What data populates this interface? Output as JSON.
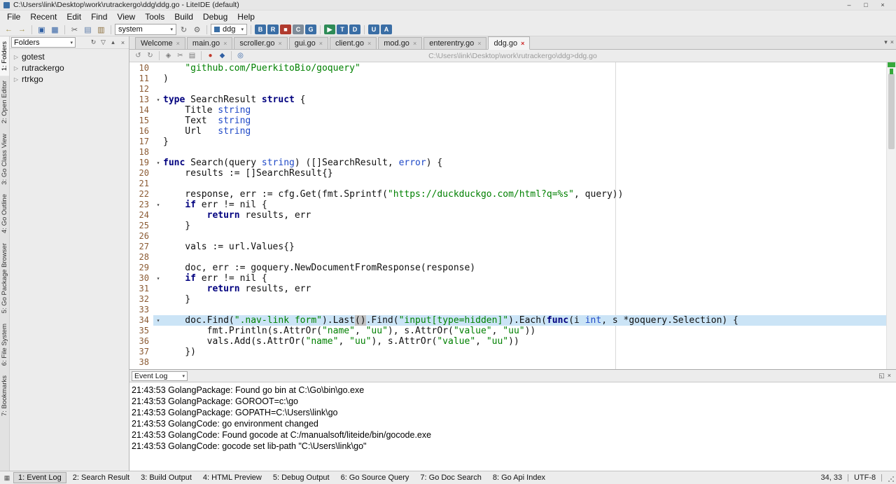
{
  "window": {
    "title": "C:\\Users\\link\\Desktop\\work\\rutrackergo\\ddg\\ddg.go - LiteIDE (default)",
    "minimize": "–",
    "maximize": "□",
    "close": "×"
  },
  "colors": {
    "chrome": "#ececec",
    "editor_bg": "#ffffff",
    "current_line": "#cbe4f6",
    "keyword": "#00007f",
    "type": "#1f49c7",
    "string": "#008000",
    "line_number": "#8b5a32",
    "modified_mark": "#37a93c",
    "active_tab_close": "#cc2222"
  },
  "menubar": {
    "items": [
      "File",
      "Recent",
      "Edit",
      "Find",
      "View",
      "Tools",
      "Build",
      "Debug",
      "Help"
    ]
  },
  "toolbar": {
    "items": [
      {
        "t": "icon",
        "name": "back-icon",
        "g": "←",
        "c": "#9f8f46"
      },
      {
        "t": "icon",
        "name": "forward-icon",
        "g": "→",
        "c": "#9f8f46"
      },
      {
        "t": "sep"
      },
      {
        "t": "icon",
        "name": "save-icon",
        "g": "▣",
        "c": "#2f5fa3"
      },
      {
        "t": "icon",
        "name": "save-all-icon",
        "g": "▦",
        "c": "#2f5fa3"
      },
      {
        "t": "sep"
      },
      {
        "t": "icon",
        "name": "cut-icon",
        "g": "✂",
        "c": "#5c5c5c"
      },
      {
        "t": "icon",
        "name": "copy-icon",
        "g": "▤",
        "c": "#5c7ba8"
      },
      {
        "t": "icon",
        "name": "paste-icon",
        "g": "▥",
        "c": "#8a6d3a"
      },
      {
        "t": "sep"
      },
      {
        "t": "combo",
        "name": "env-combo",
        "value": "system"
      },
      {
        "t": "icon",
        "name": "reload-env-icon",
        "g": "↻",
        "c": "#666666"
      },
      {
        "t": "icon",
        "name": "gear-icon",
        "g": "⚙",
        "c": "#666666"
      },
      {
        "t": "sep"
      },
      {
        "t": "field",
        "name": "target-field",
        "value": "ddg"
      },
      {
        "t": "sep"
      },
      {
        "t": "build",
        "name": "build-icon",
        "g": "B",
        "c": "#3a6ea5"
      },
      {
        "t": "build",
        "name": "build-run-icon",
        "g": "R",
        "c": "#3a6ea5"
      },
      {
        "t": "build",
        "name": "stop-icon",
        "g": "■",
        "c": "#b03a2e"
      },
      {
        "t": "build",
        "name": "clean-icon",
        "g": "C",
        "c": "#7f8c99"
      },
      {
        "t": "build",
        "name": "get-icon",
        "g": "G",
        "c": "#3a6ea5"
      },
      {
        "t": "sep"
      },
      {
        "t": "build",
        "name": "run-icon",
        "g": "▶",
        "c": "#2e8b57"
      },
      {
        "t": "build",
        "name": "test-icon",
        "g": "T",
        "c": "#3a6ea5"
      },
      {
        "t": "build",
        "name": "debug-icon",
        "g": "D",
        "c": "#3a6ea5"
      },
      {
        "t": "sep"
      },
      {
        "t": "build",
        "name": "godoc-icon",
        "g": "U",
        "c": "#3a6ea5"
      },
      {
        "t": "build",
        "name": "api-icon",
        "g": "A",
        "c": "#3a6ea5"
      }
    ]
  },
  "side_tabs": {
    "active_index": 0,
    "items": [
      "1: Folders",
      "2: Open Editor",
      "3: Go Class View",
      "4: Go Outline",
      "5: Go Package Browser",
      "6: File System",
      "7: Bookmarks"
    ]
  },
  "folders_pane": {
    "title": "Folders",
    "icons": [
      {
        "name": "sync-icon",
        "g": "↻"
      },
      {
        "name": "filter-icon",
        "g": "▽"
      },
      {
        "name": "collapse-all-icon",
        "g": "▴"
      },
      {
        "name": "close-pane-icon",
        "g": "×"
      }
    ],
    "items": [
      "gotest",
      "rutrackergo",
      "rtrkgo"
    ]
  },
  "editor": {
    "tabs": [
      {
        "label": "Welcome"
      },
      {
        "label": "main.go"
      },
      {
        "label": "scroller.go"
      },
      {
        "label": "gui.go"
      },
      {
        "label": "client.go"
      },
      {
        "label": "mod.go"
      },
      {
        "label": "enterentry.go"
      },
      {
        "label": "ddg.go",
        "active": true
      }
    ],
    "tabbar_controls": [
      {
        "name": "tab-list-icon",
        "g": "▾"
      },
      {
        "name": "tab-close-all-icon",
        "g": "×"
      }
    ],
    "toolbar_icons": [
      {
        "t": "icon",
        "name": "undo-icon",
        "g": "↺",
        "c": "#7a7a7a"
      },
      {
        "t": "icon",
        "name": "redo-icon",
        "g": "↻",
        "c": "#7a7a7a"
      },
      {
        "t": "sep"
      },
      {
        "t": "icon",
        "name": "lock-icon",
        "g": "◈",
        "c": "#7a7a7a"
      },
      {
        "t": "icon",
        "name": "cut-icon",
        "g": "✂",
        "c": "#7a7a7a"
      },
      {
        "t": "icon",
        "name": "copy-icon",
        "g": "▤",
        "c": "#7a7a7a"
      },
      {
        "t": "sep"
      },
      {
        "t": "icon",
        "name": "record-icon",
        "g": "●",
        "c": "#c0392b"
      },
      {
        "t": "icon",
        "name": "build-file-icon",
        "g": "◆",
        "c": "#2f5fa3"
      },
      {
        "t": "sep"
      },
      {
        "t": "icon",
        "name": "grep-icon",
        "g": "◎",
        "c": "#2f5fa3"
      }
    ],
    "path": "C:\\Users\\link\\Desktop\\work\\rutrackergo\\ddg>ddg.go",
    "active_line": 34,
    "lines": [
      {
        "n": 10,
        "tk": [
          [
            "p",
            "    "
          ],
          [
            "s",
            "\"github.com/PuerkitoBio/goquery\""
          ]
        ]
      },
      {
        "n": 11,
        "tk": [
          [
            "p",
            ")"
          ]
        ]
      },
      {
        "n": 12,
        "tk": []
      },
      {
        "n": 13,
        "fold": true,
        "tk": [
          [
            "k",
            "type"
          ],
          [
            "p",
            " SearchResult "
          ],
          [
            "k",
            "struct"
          ],
          [
            "p",
            " {"
          ]
        ]
      },
      {
        "n": 14,
        "tk": [
          [
            "p",
            "    Title "
          ],
          [
            "t",
            "string"
          ]
        ]
      },
      {
        "n": 15,
        "tk": [
          [
            "p",
            "    Text  "
          ],
          [
            "t",
            "string"
          ]
        ]
      },
      {
        "n": 16,
        "tk": [
          [
            "p",
            "    Url   "
          ],
          [
            "t",
            "string"
          ]
        ]
      },
      {
        "n": 17,
        "tk": [
          [
            "p",
            "}"
          ]
        ]
      },
      {
        "n": 18,
        "tk": []
      },
      {
        "n": 19,
        "fold": true,
        "tk": [
          [
            "k",
            "func"
          ],
          [
            "p",
            " Search(query "
          ],
          [
            "t",
            "string"
          ],
          [
            "p",
            ") ([]SearchResult, "
          ],
          [
            "t",
            "error"
          ],
          [
            "p",
            ") {"
          ]
        ]
      },
      {
        "n": 20,
        "tk": [
          [
            "p",
            "    results := []SearchResult{}"
          ]
        ]
      },
      {
        "n": 21,
        "tk": []
      },
      {
        "n": 22,
        "tk": [
          [
            "p",
            "    response, err := cfg.Get(fmt.Sprintf("
          ],
          [
            "s",
            "\"https://duckduckgo.com/html?q=%s\""
          ],
          [
            "p",
            ", query))"
          ]
        ]
      },
      {
        "n": 23,
        "fold": true,
        "tk": [
          [
            "p",
            "    "
          ],
          [
            "k",
            "if"
          ],
          [
            "p",
            " err != nil {"
          ]
        ]
      },
      {
        "n": 24,
        "tk": [
          [
            "p",
            "        "
          ],
          [
            "k",
            "return"
          ],
          [
            "p",
            " results, err"
          ]
        ]
      },
      {
        "n": 25,
        "tk": [
          [
            "p",
            "    }"
          ]
        ]
      },
      {
        "n": 26,
        "tk": []
      },
      {
        "n": 27,
        "tk": [
          [
            "p",
            "    vals := url.Values{}"
          ]
        ]
      },
      {
        "n": 28,
        "tk": []
      },
      {
        "n": 29,
        "tk": [
          [
            "p",
            "    doc, err := goquery.NewDocumentFromResponse(response)"
          ]
        ]
      },
      {
        "n": 30,
        "fold": true,
        "tk": [
          [
            "p",
            "    "
          ],
          [
            "k",
            "if"
          ],
          [
            "p",
            " err != nil {"
          ]
        ]
      },
      {
        "n": 31,
        "tk": [
          [
            "p",
            "        "
          ],
          [
            "k",
            "return"
          ],
          [
            "p",
            " results, err"
          ]
        ]
      },
      {
        "n": 32,
        "tk": [
          [
            "p",
            "    }"
          ]
        ]
      },
      {
        "n": 33,
        "tk": []
      },
      {
        "n": 34,
        "fold": true,
        "tk": [
          [
            "p",
            "    doc.Find("
          ],
          [
            "s",
            "\".nav-link form\""
          ],
          [
            "p",
            ").Last"
          ],
          [
            "h",
            "()"
          ],
          [
            "p",
            ".Find("
          ],
          [
            "s",
            "\"input[type=hidden]\""
          ],
          [
            "p",
            ").Each("
          ],
          [
            "k",
            "func"
          ],
          [
            "p",
            "(i "
          ],
          [
            "t",
            "int"
          ],
          [
            "p",
            ", s *goquery.Selection) {"
          ]
        ]
      },
      {
        "n": 35,
        "tk": [
          [
            "p",
            "        fmt.Println(s.AttrOr("
          ],
          [
            "s",
            "\"name\""
          ],
          [
            "p",
            ", "
          ],
          [
            "s",
            "\"uu\""
          ],
          [
            "p",
            "), s.AttrOr("
          ],
          [
            "s",
            "\"value\""
          ],
          [
            "p",
            ", "
          ],
          [
            "s",
            "\"uu\""
          ],
          [
            "p",
            "))"
          ]
        ]
      },
      {
        "n": 36,
        "tk": [
          [
            "p",
            "        vals.Add(s.AttrOr("
          ],
          [
            "s",
            "\"name\""
          ],
          [
            "p",
            ", "
          ],
          [
            "s",
            "\"uu\""
          ],
          [
            "p",
            "), s.AttrOr("
          ],
          [
            "s",
            "\"value\""
          ],
          [
            "p",
            ", "
          ],
          [
            "s",
            "\"uu\""
          ],
          [
            "p",
            "))"
          ]
        ]
      },
      {
        "n": 37,
        "tk": [
          [
            "p",
            "    })"
          ]
        ]
      },
      {
        "n": 38,
        "tk": []
      }
    ]
  },
  "event_log": {
    "title": "Event Log",
    "icons": [
      {
        "name": "float-panel-icon",
        "g": "◱"
      },
      {
        "name": "close-panel-icon",
        "g": "×"
      }
    ],
    "lines": [
      "21:43:53 GolangPackage: Found go bin at C:\\Go\\bin\\go.exe",
      "21:43:53 GolangPackage: GOROOT=c:\\go",
      "21:43:53 GolangPackage: GOPATH=C:\\Users\\link\\go",
      "21:43:53 GolangCode: go environment changed",
      "21:43:53 GolangCode: Found gocode at C:/manualsoft/liteide/bin/gocode.exe",
      "21:43:53 GolangCode: gocode set lib-path \"C:\\Users\\link\\go\""
    ]
  },
  "statusbar": {
    "active_index": 0,
    "panels": [
      "1: Event Log",
      "2: Search Result",
      "3: Build Output",
      "4: HTML Preview",
      "5: Debug Output",
      "6: Go Source Query",
      "7: Go Doc Search",
      "8: Go Api Index"
    ],
    "cursor": "34, 33",
    "encoding": "UTF-8"
  }
}
